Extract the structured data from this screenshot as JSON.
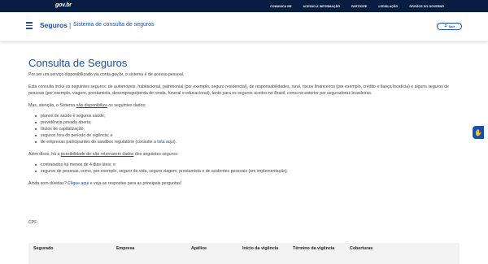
{
  "govbar": {
    "logo": "gov.br",
    "links": [
      "COMUNICA BR",
      "ACESSO À INFORMAÇÃO",
      "PARTICIPE",
      "LEGISLAÇÃO",
      "ÓRGÃOS DO GOVERNO"
    ]
  },
  "header": {
    "title": "Seguros",
    "separator": "|",
    "subtitle": "Sistema de consulta de seguros",
    "logout_label": "Sair"
  },
  "main": {
    "heading": "Consulta de Seguros",
    "intro": "Por ser um serviço disponibilizado via conta gov.br, o sistema é de acesso pessoal.",
    "scope": "Esta consulta inclui os seguintes seguros: de automóveis, habitacional, patrimonial (por exemplo, seguro residencial), de responsabilidades, rural, riscos financeiros (por exemplo, crédito e fiança locatícia) e alguns seguros de pessoas (por exemplo, viagem, prestamista, desemprego/perda de renda, funeral e educacional), tanto para os seguros aceitos no Brasil, como no exterior por seguradoras brasileiras.",
    "warning_prefix": "Mas, atenção, o Sistema ",
    "warning_underlined": "não disponibiliza",
    "warning_suffix": " os seguintes dados:",
    "unavailable": [
      "planos de saúde e seguros saúde;",
      "previdência privada aberta;",
      "títulos de capitalização;",
      "seguros fora do período de vigência; e"
    ],
    "sandbox_prefix": "de empresas participantes do sandbox regulatório (consulte a ",
    "sandbox_link": "lista aqui",
    "sandbox_suffix": ").",
    "besides_prefix": "Além disso, há a ",
    "besides_underlined": "possibilidade de não retornarem dados",
    "besides_suffix": " dos seguintes seguros:",
    "maybe_missing": [
      "contratados há menos de 4 dias úteis; e",
      "seguros de pessoas, como, por exemplo, seguro de vida, seguro viagem, prestamista e de acidentes pessoais (em implementação)."
    ],
    "doubts_prefix": "Ainda com dúvidas? ",
    "doubts_link": "Clique aqui",
    "doubts_suffix": " e veja as respostas para as principais perguntas!",
    "cpf_label": "CPF:"
  },
  "table": {
    "columns": [
      "Segurado",
      "Empresa",
      "Apólice",
      "Início da vigência",
      "Término da vigência",
      "Coberturas"
    ]
  },
  "icons": {
    "menu": "hamburger-icon",
    "logout": "sign-out-icon",
    "accessibility": "sign-language-icon"
  },
  "colors": {
    "govbar_bg": "#071d41",
    "primary": "#1351b4",
    "table_head_bg": "#f3f3f3"
  }
}
